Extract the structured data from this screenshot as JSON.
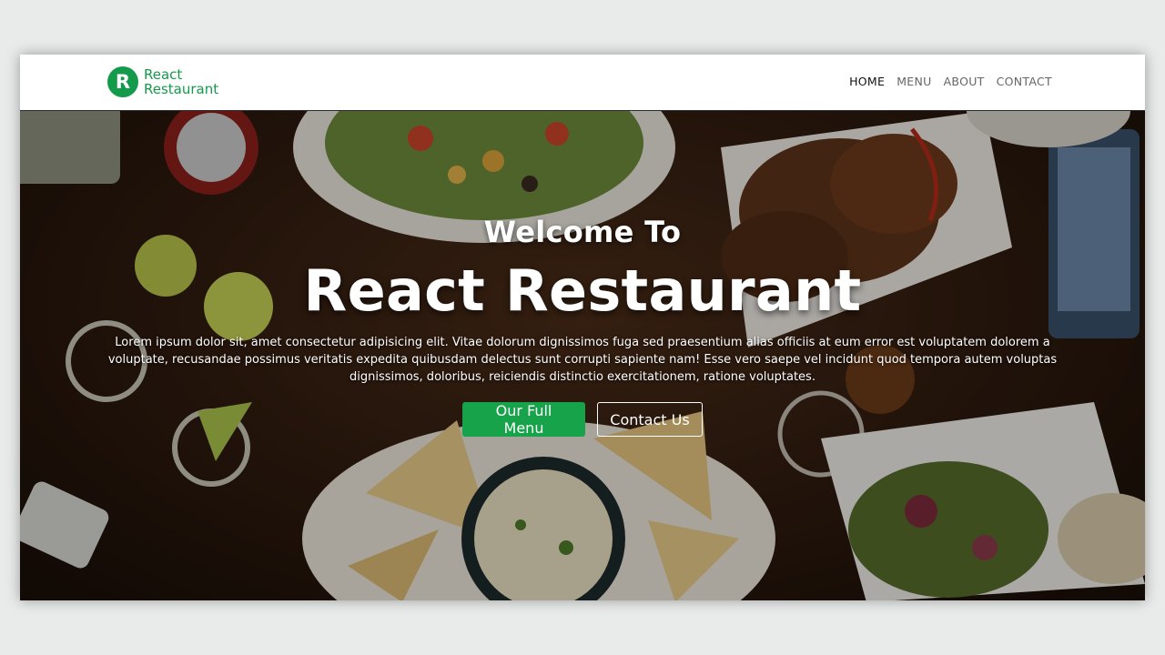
{
  "brand": {
    "logo_letter": "R",
    "line1": "React",
    "line2": "Restaurant",
    "color": "#139a4b"
  },
  "nav": {
    "items": [
      {
        "label": "HOME",
        "active": true
      },
      {
        "label": "MENU"
      },
      {
        "label": "ABOUT"
      },
      {
        "label": "CONTACT"
      }
    ]
  },
  "hero": {
    "subtitle": "Welcome To",
    "title": "React Restaurant",
    "text": "Lorem ipsum dolor sit, amet consectetur adipisicing elit. Vitae dolorum dignissimos fuga sed praesentium alias officiis at eum error est voluptatem dolorem a voluptate, recusandae possimus veritatis expedita quibusdam delectus sunt corrupti sapiente nam! Esse vero saepe vel incidunt quod tempora autem voluptas dignissimos, doloribus, reiciendis distinctio exercitationem, ratione voluptates.",
    "primary_button": "Our Full Menu",
    "secondary_button": "Contact Us",
    "background_image": "restaurant-food-table-photo"
  },
  "colors": {
    "accent": "#16a34a",
    "page_background": "#e9ebeb"
  }
}
